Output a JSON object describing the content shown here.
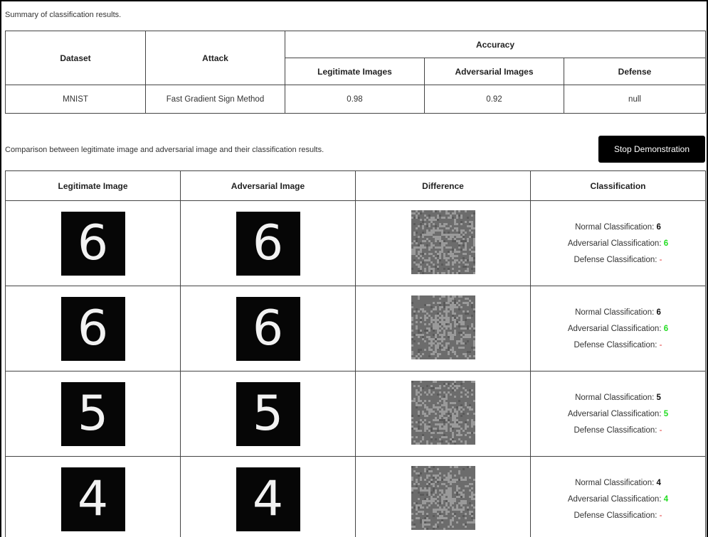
{
  "summary": {
    "caption": "Summary of classification results.",
    "headers": {
      "dataset": "Dataset",
      "attack": "Attack",
      "accuracy": "Accuracy",
      "legitimate": "Legitimate Images",
      "adversarial": "Adversarial Images",
      "defense": "Defense"
    },
    "row": {
      "dataset": "MNIST",
      "attack": "Fast Gradient Sign Method",
      "legitimate": "0.98",
      "adversarial": "0.92",
      "defense": "null"
    }
  },
  "comparison": {
    "caption": "Comparison between legitimate image and adversarial image and their classification results.",
    "stop_button": "Stop Demonstration",
    "headers": {
      "legitimate": "Legitimate Image",
      "adversarial": "Adversarial Image",
      "difference": "Difference",
      "classification": "Classification"
    },
    "labels": {
      "normal": "Normal Classification: ",
      "adversarial": "Adversarial Classification: ",
      "defense": "Defense Classification: "
    },
    "rows": [
      {
        "legit_digit": "6",
        "adv_digit": "6",
        "normal": "6",
        "adversarial": "6",
        "defense": "-"
      },
      {
        "legit_digit": "6",
        "adv_digit": "6",
        "normal": "6",
        "adversarial": "6",
        "defense": "-"
      },
      {
        "legit_digit": "5",
        "adv_digit": "5",
        "normal": "5",
        "adversarial": "5",
        "defense": "-"
      },
      {
        "legit_digit": "4",
        "adv_digit": "4",
        "normal": "4",
        "adversarial": "4",
        "defense": "-"
      }
    ]
  },
  "colors": {
    "adversarial_text": "#22dd22",
    "defense_text": "#e03030",
    "diff_background": "#6c6c6c",
    "diff_noise": "#9a9a9a"
  }
}
